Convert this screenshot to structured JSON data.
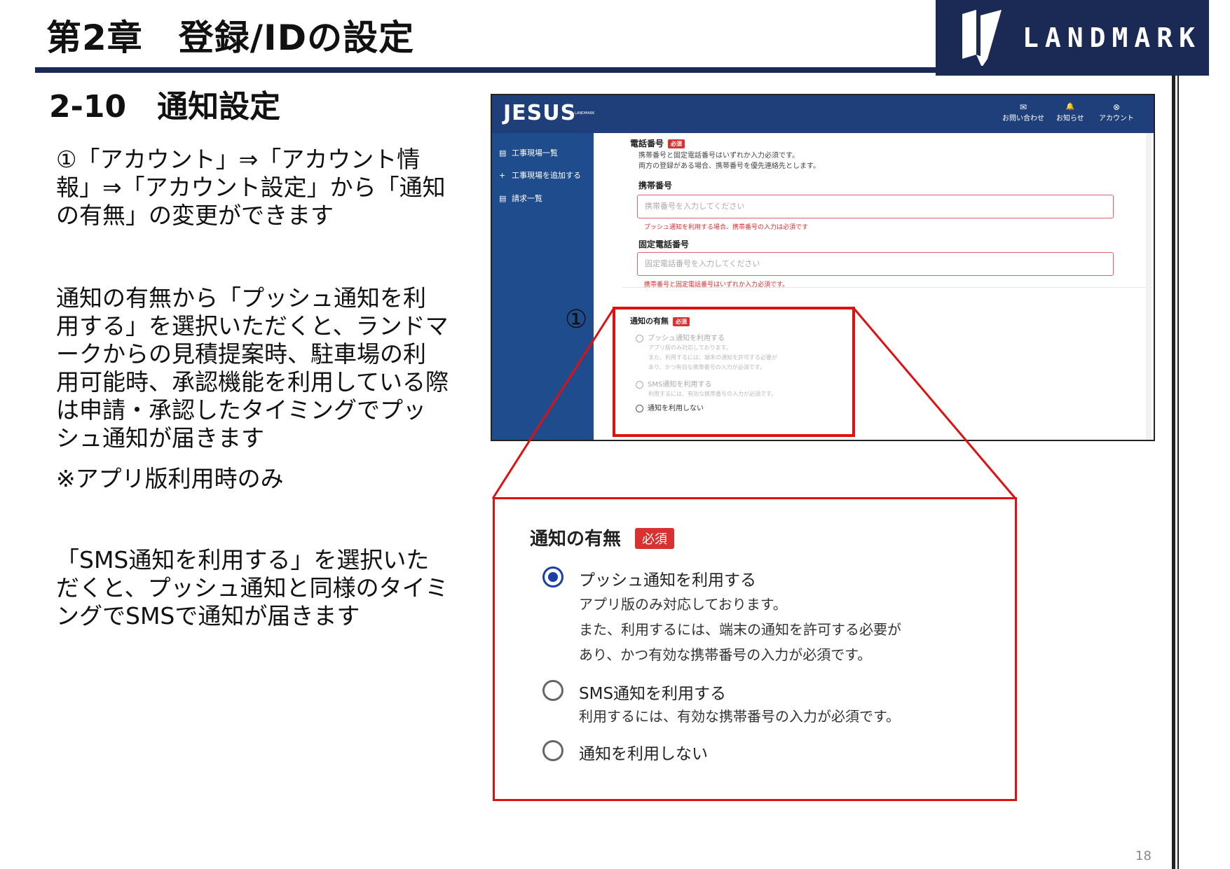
{
  "slide": {
    "chapter_title": "第2章　登録/IDの設定",
    "section_title": "2-10　通知設定",
    "logo_text": "LANDMARK",
    "page_number": "18"
  },
  "description": {
    "para1": "①「アカウント」⇒「アカウント情報」⇒「アカウント設定」から「通知の有無」の変更ができます",
    "para2": "通知の有無から「プッシュ通知を利用する」を選択いただくと、ランドマークからの見積提案時、駐車場の利用可能時、承認機能を利用している際は申請・承認したタイミングでプッシュ通知が届きます",
    "note": "※アプリ版利用時のみ",
    "para3": "「SMS通知を利用する」を選択いただくと、プッシュ通知と同様のタイミングでSMSで通知が届きます"
  },
  "marker": "①",
  "app": {
    "brand": "JESUS",
    "brand_sub": "LANDMARK",
    "header_buttons": [
      {
        "icon": "mail-icon",
        "glyph": "✉",
        "label": "お問い合わせ"
      },
      {
        "icon": "bell-icon",
        "glyph": "🔔",
        "label": "お知らせ"
      },
      {
        "icon": "account-icon",
        "glyph": "⊗",
        "label": "アカウント"
      }
    ],
    "sidebar": [
      {
        "icon": "list-icon",
        "glyph": "▤",
        "label": "工事現場一覧"
      },
      {
        "icon": "plus-icon",
        "glyph": "+",
        "label": "工事現場を追加する"
      },
      {
        "icon": "invoice-icon",
        "glyph": "▤",
        "label": "請求一覧"
      }
    ],
    "phone_label": "電話番号",
    "required": "必須",
    "phone_help_1": "携帯番号と固定電話番号はいずれか入力必須です。",
    "phone_help_2": "両方の登録がある場合、携帯番号を優先連絡先とします。",
    "mobile_label": "携帯番号",
    "mobile_placeholder": "携帯番号を入力してください",
    "mobile_error": "プッシュ通知を利用する場合、携帯番号の入力は必須です",
    "landline_label": "固定電話番号",
    "landline_placeholder": "固定電話番号を入力してください",
    "landline_error": "携帯番号と固定電話番号はいずれか入力必須です。"
  },
  "notification": {
    "title": "通知の有無",
    "required": "必須",
    "options": [
      {
        "label": "プッシュ通知を利用する",
        "selected": true,
        "desc": [
          "アプリ版のみ対応しております。",
          "また、利用するには、端末の通知を許可する必要が",
          "あり、かつ有効な携帯番号の入力が必須です。"
        ]
      },
      {
        "label": "SMS通知を利用する",
        "selected": false,
        "desc": [
          "利用するには、有効な携帯番号の入力が必須です。"
        ]
      },
      {
        "label": "通知を利用しない",
        "selected": false,
        "desc": []
      }
    ]
  },
  "colors": {
    "navy": "#1b2a55",
    "app_header": "#1f3f7a",
    "app_sidebar": "#1f4c8d",
    "highlight_red": "#dd1111",
    "radio_blue": "#1a3fa8"
  }
}
